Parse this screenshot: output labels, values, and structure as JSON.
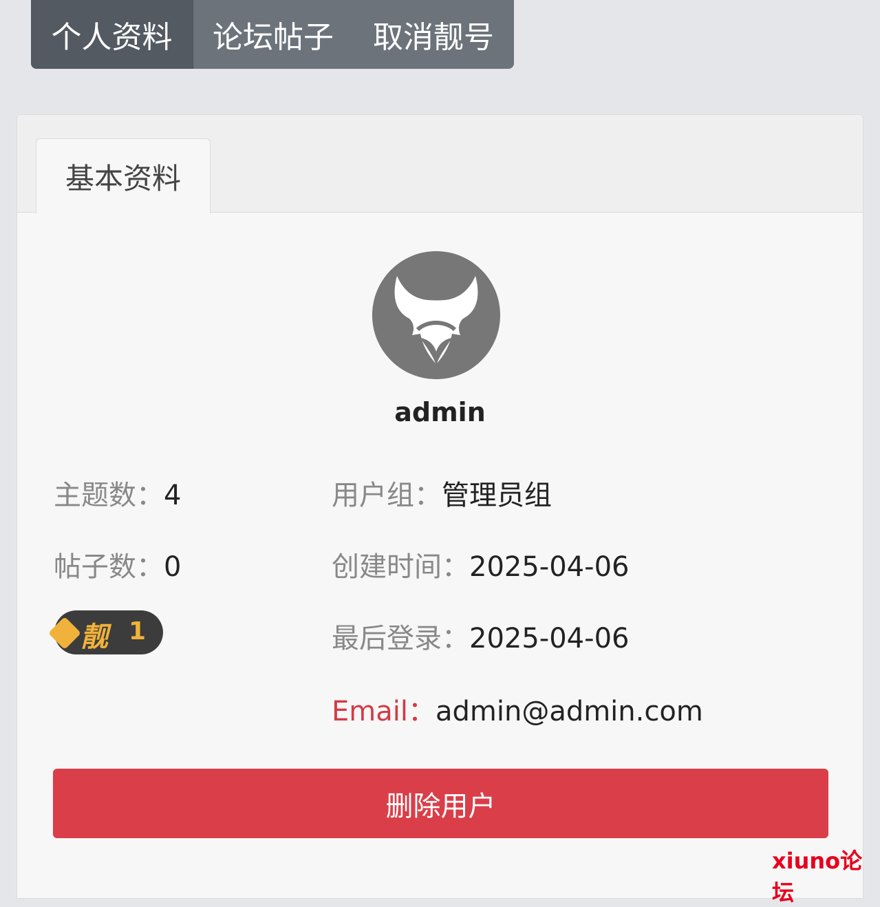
{
  "topnav": {
    "tabs": [
      {
        "label": "个人资料"
      },
      {
        "label": "论坛帖子"
      },
      {
        "label": "取消靓号"
      }
    ]
  },
  "card": {
    "tab_label": "基本资料"
  },
  "profile": {
    "username": "admin",
    "threads_label": "主题数：",
    "threads_value": "4",
    "posts_label": "帖子数：",
    "posts_value": "0",
    "badge_char": "靓",
    "badge_count": "1",
    "group_label": "用户组：",
    "group_value": "管理员组",
    "created_label": "创建时间：",
    "created_value": "2025-04-06",
    "lastlogin_label": "最后登录：",
    "lastlogin_value": "2025-04-06",
    "email_label": "Email：",
    "email_value": "admin@admin.com"
  },
  "actions": {
    "delete_label": "删除用户"
  },
  "watermark": "xiuno论坛",
  "colors": {
    "nav_bg": "#6c737b",
    "nav_active": "#545a62",
    "danger": "#da3e48",
    "badge_gold": "#f0b23a"
  }
}
